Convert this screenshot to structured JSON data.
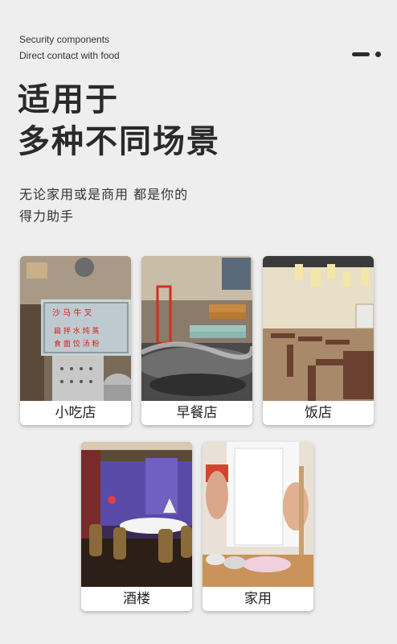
{
  "header": {
    "subtitle_line1": "Security components",
    "subtitle_line2": "Direct contact with food",
    "title_line1": "适用于",
    "title_line2": "多种不同场景",
    "desc_line1": "无论家用或是商用 都是你的",
    "desc_line2": "得力助手"
  },
  "scenes": [
    {
      "label": "小吃店"
    },
    {
      "label": "早餐店"
    },
    {
      "label": "饭店"
    },
    {
      "label": "酒楼"
    },
    {
      "label": "家用"
    }
  ],
  "colors": {
    "background": "#eeeeee",
    "card": "#ffffff",
    "text_dark": "#2a2a2a"
  }
}
